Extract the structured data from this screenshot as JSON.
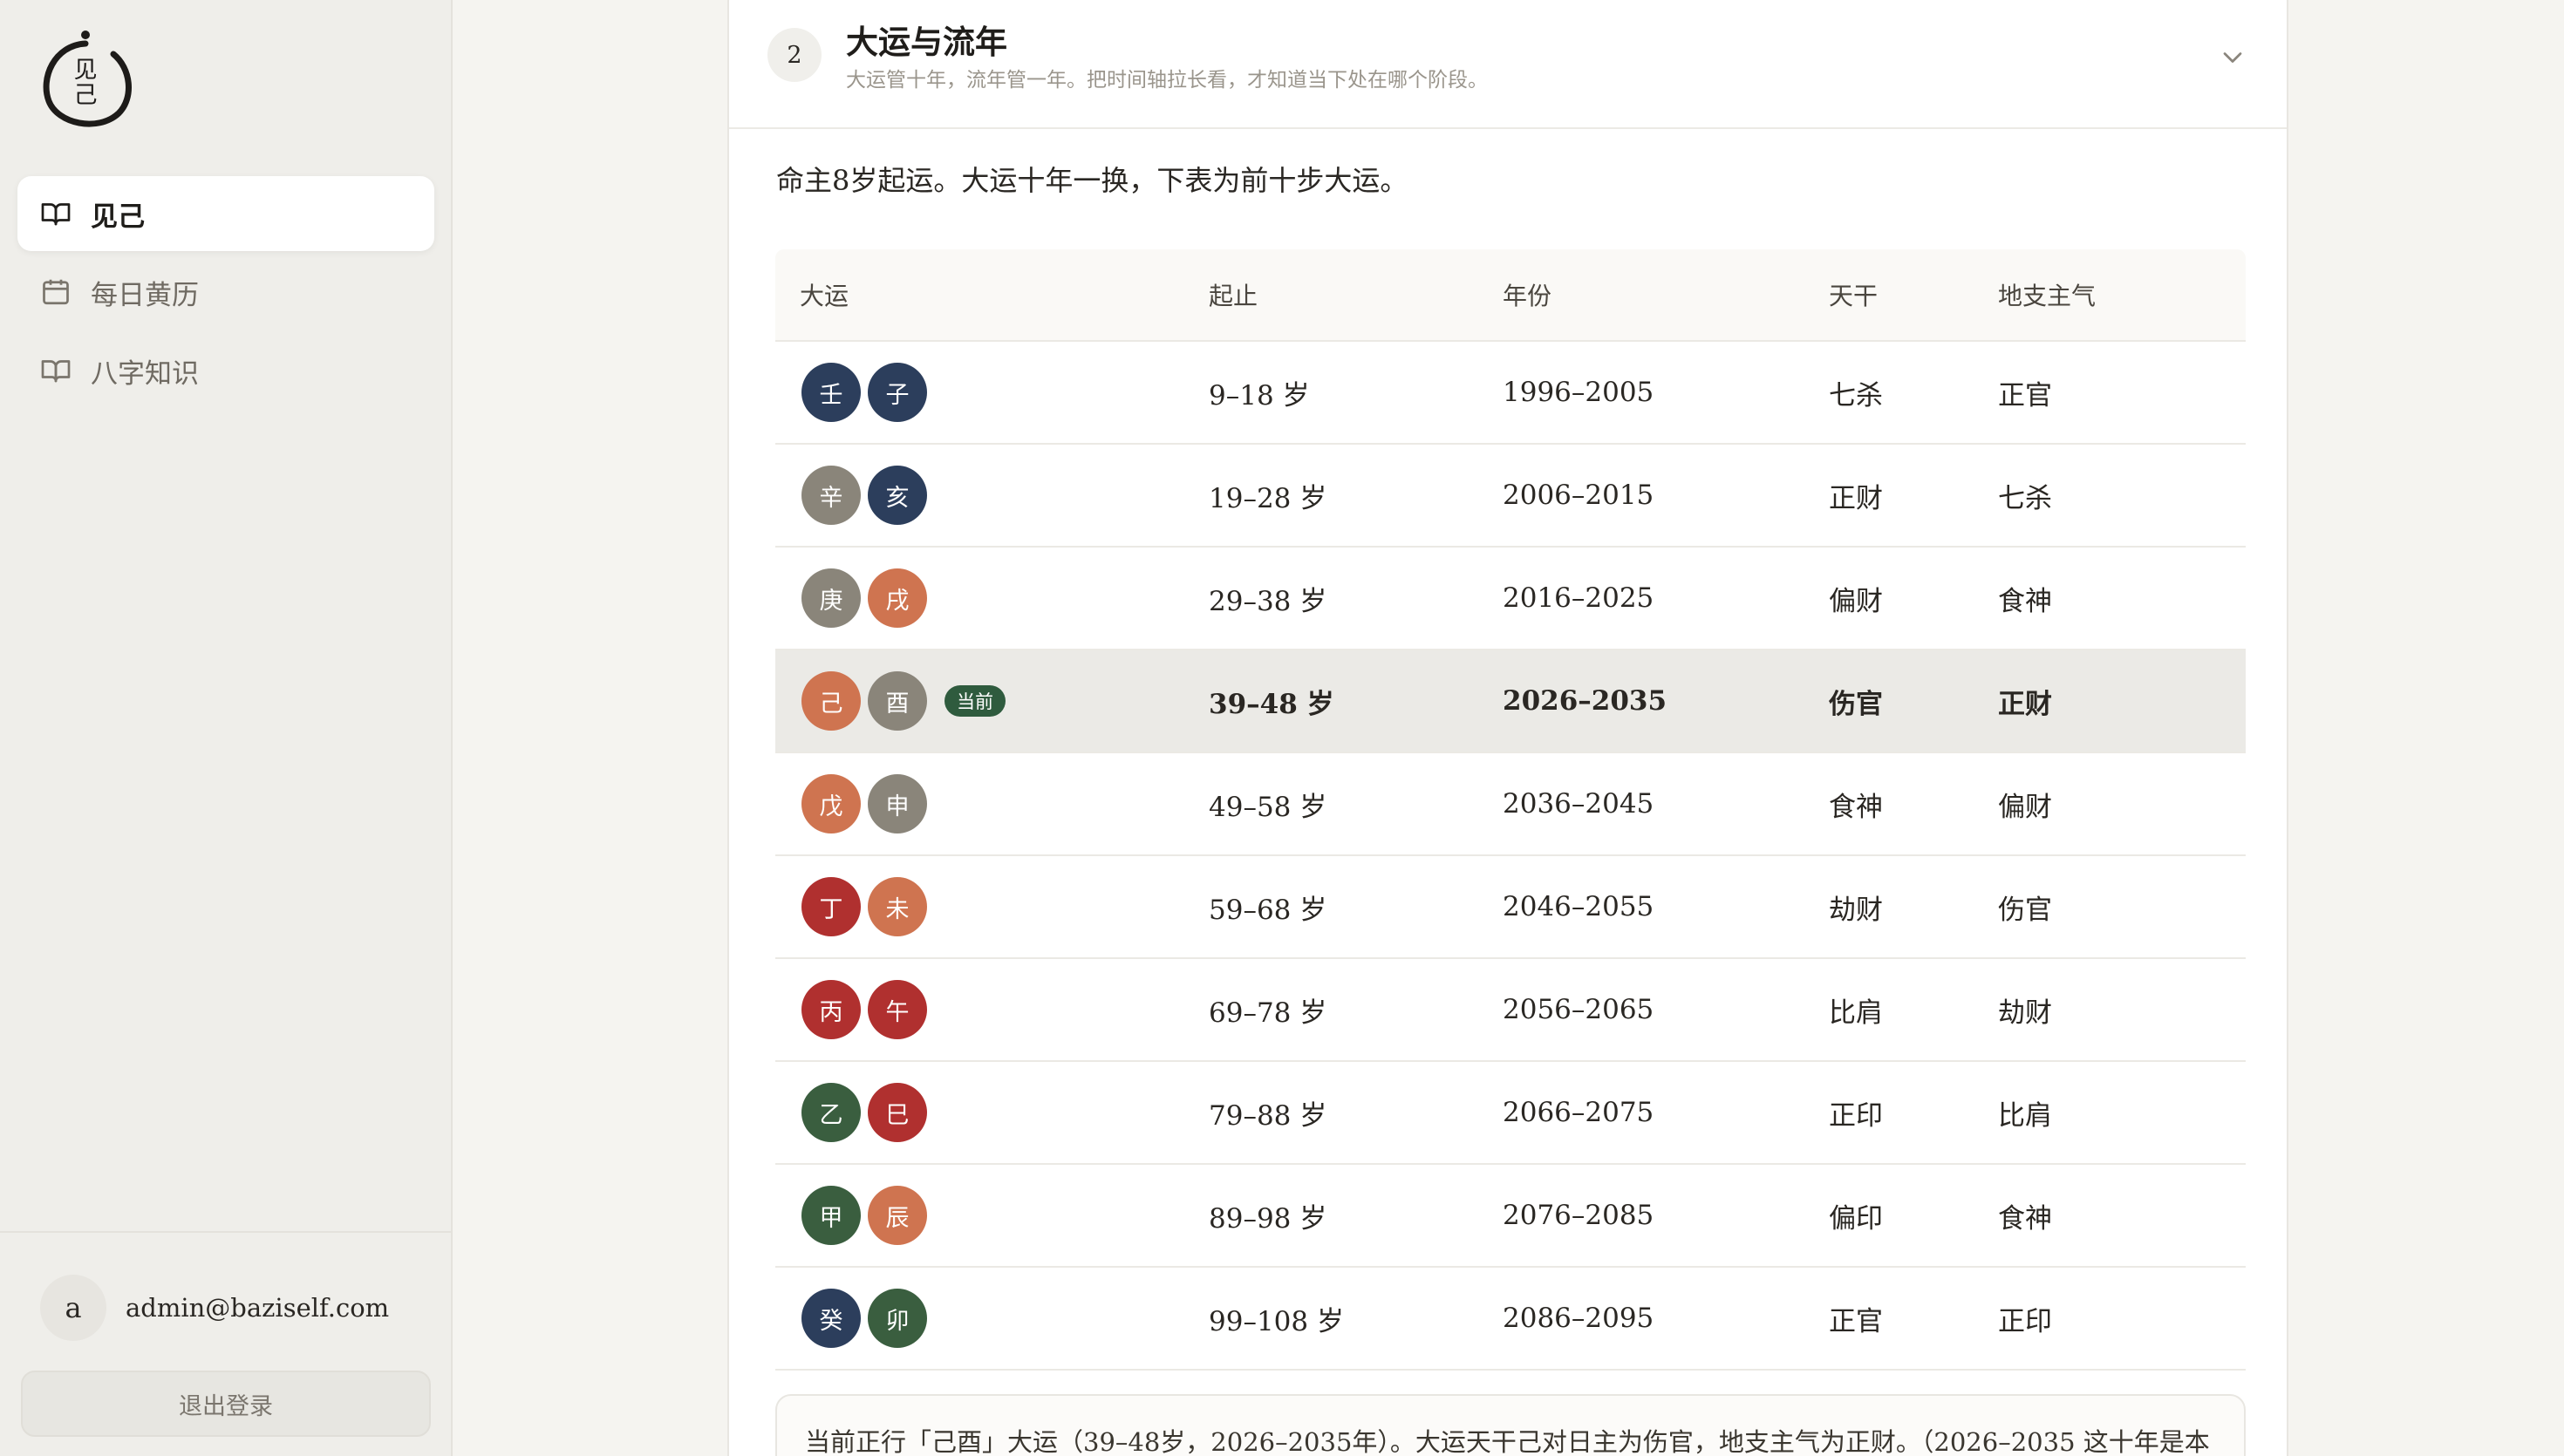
{
  "sidebar": {
    "logo_text": "见\n己",
    "nav": [
      {
        "label": "见己",
        "icon": "book-open-icon",
        "active": true
      },
      {
        "label": "每日黄历",
        "icon": "calendar-icon",
        "active": false
      },
      {
        "label": "八字知识",
        "icon": "book-open-icon",
        "active": false
      }
    ],
    "user": {
      "avatar": "a",
      "email": "admin@baziself.com"
    },
    "logout_label": "退出登录"
  },
  "section": {
    "step": "2",
    "title": "大运与流年",
    "subtitle": "大运管十年，流年管一年。把时间轴拉长看，才知道当下处在哪个阶段。",
    "intro": "命主8岁起运。大运十年一换，下表为前十步大运。"
  },
  "table": {
    "headers": [
      "大运",
      "起止",
      "年份",
      "天干",
      "地支主气"
    ],
    "current_badge": "当前",
    "rows": [
      {
        "stem": "壬",
        "stem_color": "#2c3e5c",
        "branch": "子",
        "branch_color": "#2c3e5c",
        "age": "9–18 岁",
        "years": "1996–2005",
        "gan": "七杀",
        "zhi": "正官",
        "current": false
      },
      {
        "stem": "辛",
        "stem_color": "#8a857a",
        "branch": "亥",
        "branch_color": "#2c3e5c",
        "age": "19–28 岁",
        "years": "2006–2015",
        "gan": "正财",
        "zhi": "七杀",
        "current": false
      },
      {
        "stem": "庚",
        "stem_color": "#8a857a",
        "branch": "戌",
        "branch_color": "#cf7450",
        "age": "29–38 岁",
        "years": "2016–2025",
        "gan": "偏财",
        "zhi": "食神",
        "current": false
      },
      {
        "stem": "己",
        "stem_color": "#cf7450",
        "branch": "酉",
        "branch_color": "#8a857a",
        "age": "39–48 岁",
        "years": "2026–2035",
        "gan": "伤官",
        "zhi": "正财",
        "current": true
      },
      {
        "stem": "戊",
        "stem_color": "#cf7450",
        "branch": "申",
        "branch_color": "#8a857a",
        "age": "49–58 岁",
        "years": "2036–2045",
        "gan": "食神",
        "zhi": "偏财",
        "current": false
      },
      {
        "stem": "丁",
        "stem_color": "#b0302f",
        "branch": "未",
        "branch_color": "#cf7450",
        "age": "59–68 岁",
        "years": "2046–2055",
        "gan": "劫财",
        "zhi": "伤官",
        "current": false
      },
      {
        "stem": "丙",
        "stem_color": "#b0302f",
        "branch": "午",
        "branch_color": "#b0302f",
        "age": "69–78 岁",
        "years": "2056–2065",
        "gan": "比肩",
        "zhi": "劫财",
        "current": false
      },
      {
        "stem": "乙",
        "stem_color": "#3a5e3f",
        "branch": "巳",
        "branch_color": "#b0302f",
        "age": "79–88 岁",
        "years": "2066–2075",
        "gan": "正印",
        "zhi": "比肩",
        "current": false
      },
      {
        "stem": "甲",
        "stem_color": "#3a5e3f",
        "branch": "辰",
        "branch_color": "#cf7450",
        "age": "89–98 岁",
        "years": "2076–2085",
        "gan": "偏印",
        "zhi": "食神",
        "current": false
      },
      {
        "stem": "癸",
        "stem_color": "#2c3e5c",
        "branch": "卯",
        "branch_color": "#3a5e3f",
        "age": "99–108 岁",
        "years": "2086–2095",
        "gan": "正官",
        "zhi": "正印",
        "current": false
      }
    ]
  },
  "note": "当前正行「己酉」大运（39–48岁，2026–2035年）。大运天干己对日主为伤官，地支主气为正财。（2026–2035 这十年是本"
}
